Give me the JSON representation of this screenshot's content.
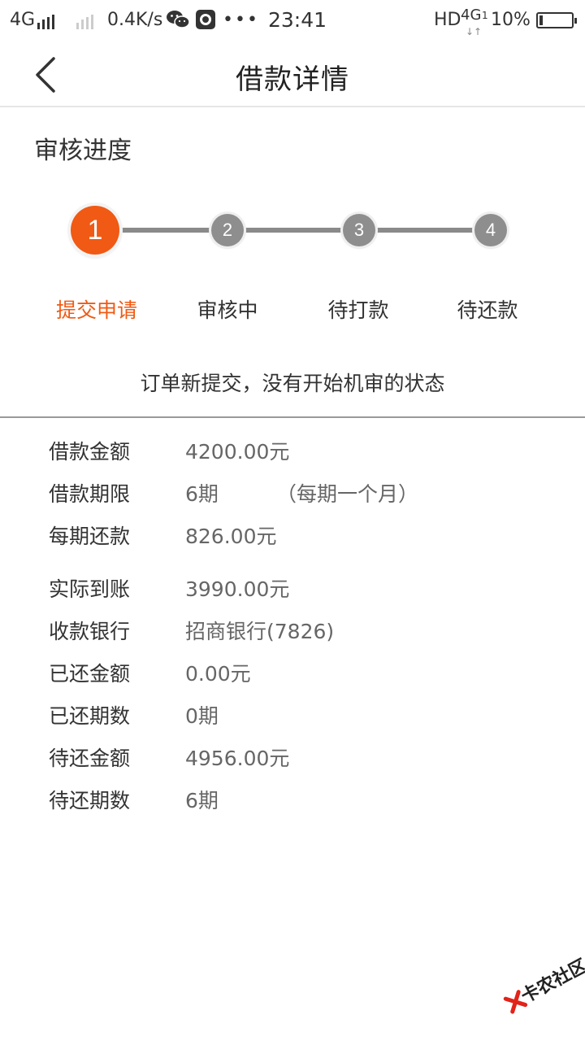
{
  "status_bar": {
    "network_left": "4G",
    "speed": "0.4K/s",
    "dots": "•••",
    "time": "23:41",
    "hd": "HD",
    "network_right": "4G",
    "network_right_sub": "1",
    "battery_pct": "10%",
    "battery_level": 0.1
  },
  "header": {
    "title": "借款详情",
    "back_icon": "chevron-left-icon"
  },
  "progress": {
    "section_title": "审核进度",
    "current_step": 1,
    "steps": [
      {
        "num": "1",
        "label": "提交申请"
      },
      {
        "num": "2",
        "label": "审核中"
      },
      {
        "num": "3",
        "label": "待打款"
      },
      {
        "num": "4",
        "label": "待还款"
      }
    ],
    "status_text": "订单新提交，没有开始机审的状态",
    "accent_color": "#f05a14",
    "inactive_color": "#8e8e8e"
  },
  "details": {
    "rows": [
      {
        "label": "借款金额",
        "value": "4200.00元"
      },
      {
        "label": "借款期限",
        "value": "6期",
        "note": "（每期一个月）"
      },
      {
        "label": "每期还款",
        "value": "826.00元"
      },
      {
        "label": "实际到账",
        "value": "3990.00元"
      },
      {
        "label": "收款银行",
        "value": "招商银行(7826)"
      },
      {
        "label": "已还金额",
        "value": "0.00元"
      },
      {
        "label": "已还期数",
        "value": "0期"
      },
      {
        "label": "待还金额",
        "value": "4956.00元"
      },
      {
        "label": "待还期数",
        "value": "6期"
      }
    ]
  },
  "watermark": {
    "text": "卡农社区"
  }
}
